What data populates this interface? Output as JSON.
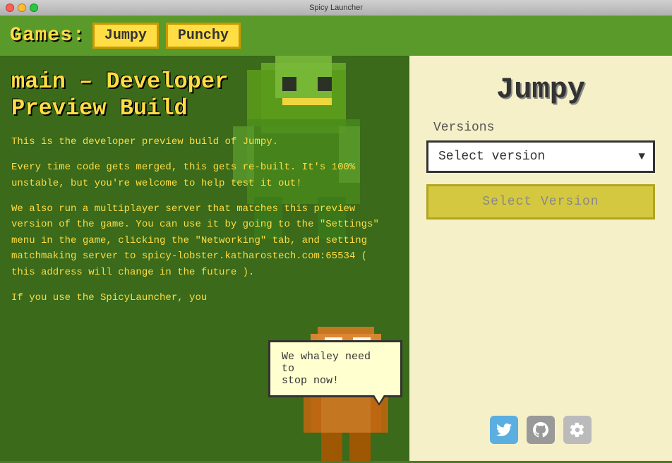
{
  "titlebar": {
    "title": "Spicy Launcher"
  },
  "nav": {
    "games_label": "Games:",
    "tabs": [
      {
        "id": "jumpy",
        "label": "Jumpy"
      },
      {
        "id": "punchy",
        "label": "Punchy"
      }
    ]
  },
  "left_panel": {
    "build_title_line1": "main – Developer",
    "build_title_line2": "Preview Build",
    "paragraph1": "This is the developer preview build of Jumpy.",
    "paragraph2": "Every time code gets merged, this gets re-built. It's 100% unstable, but you're welcome to help test it out!",
    "paragraph3": "We also run a multiplayer server that matches this preview version of the game. You can use it by going to the \"Settings\" menu in the game, clicking the \"Networking\" tab, and setting matchmaking server to spicy-lobster.katharostech.com:65534 ( this address will change in the future ).",
    "paragraph4": "If you use the SpicyLauncher, you"
  },
  "speech_bubble": {
    "line1": "We whaley need to",
    "line2": "stop now!"
  },
  "right_panel": {
    "game_name": "Jumpy",
    "versions_label": "Versions",
    "select_placeholder": "Select version",
    "select_button_label": "Select Version"
  },
  "social_icons": [
    {
      "id": "twitter",
      "symbol": "🐦",
      "label": "Twitter"
    },
    {
      "id": "github",
      "symbol": "⚙",
      "label": "GitHub"
    },
    {
      "id": "settings",
      "symbol": "⚙",
      "label": "Settings"
    }
  ],
  "colors": {
    "accent_yellow": "#ffdd44",
    "bg_green": "#3a6a1a",
    "nav_green": "#5a9a2a",
    "panel_cream": "#f5f0c8",
    "btn_yellow": "#d4c840"
  }
}
